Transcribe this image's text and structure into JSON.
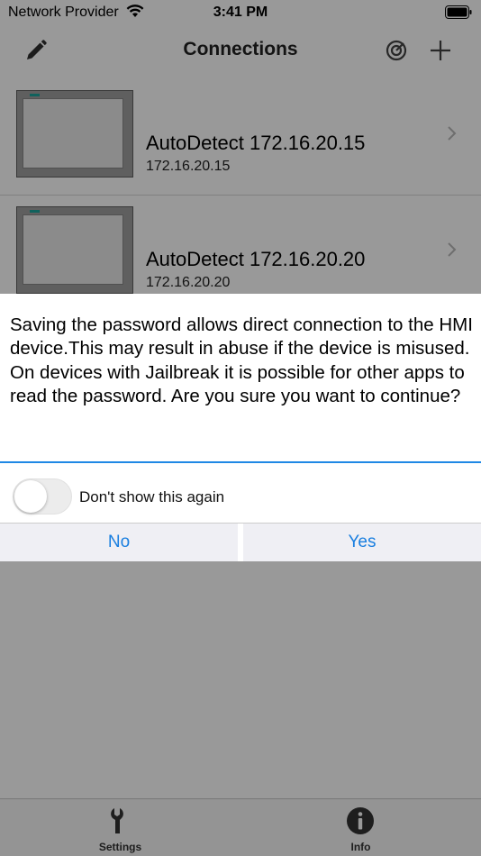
{
  "status_bar": {
    "carrier": "Network Provider",
    "time": "3:41 PM",
    "icons": [
      "wifi-icon",
      "battery-icon"
    ]
  },
  "nav": {
    "title": "Connections",
    "icons": [
      "pencil-icon",
      "target-icon",
      "plus-icon"
    ]
  },
  "connections": [
    {
      "name": "AutoDetect 172.16.20.15",
      "ip": "172.16.20.15"
    },
    {
      "name": "AutoDetect 172.16.20.20",
      "ip": "172.16.20.20"
    }
  ],
  "dialog": {
    "message": "Saving the password allows direct connection to the HMI device.This may result in abuse if the device is misused. On devices with Jailbreak it is possible for other apps to read the password. Are you sure you want to continue?",
    "toggle_label": "Don't show this again",
    "toggle_on": false,
    "no_label": "No",
    "yes_label": "Yes"
  },
  "tabs": [
    {
      "label": "Settings",
      "icon": "wrench-icon"
    },
    {
      "label": "Info",
      "icon": "info-icon"
    }
  ],
  "colors": {
    "accent": "#1a7fe0",
    "divider": "#1f88e5",
    "hmi_led": "#1ba39c"
  }
}
